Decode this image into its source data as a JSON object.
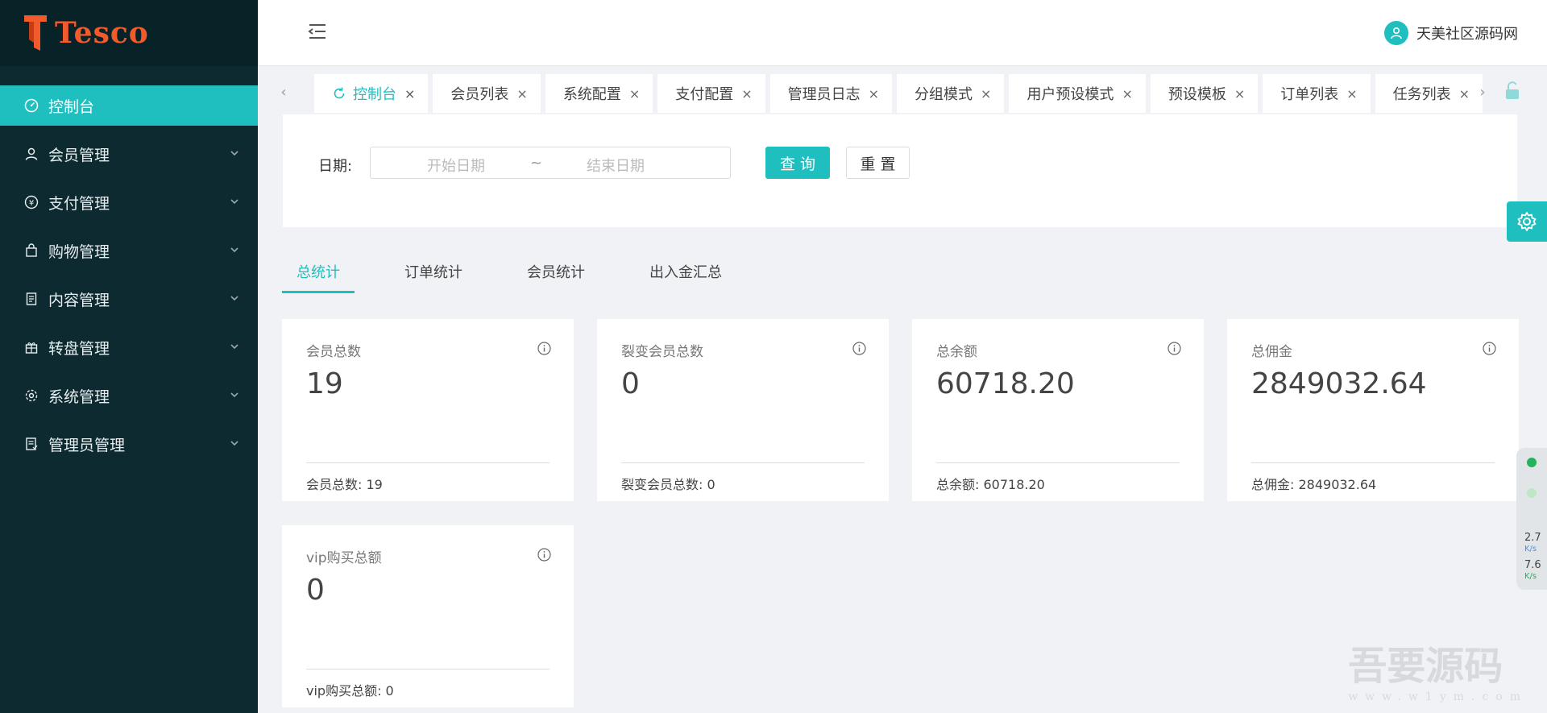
{
  "app": {
    "logo_text": "Tesco",
    "brand_color": "#f25a2b",
    "accent_color": "#1fbfbf"
  },
  "sidebar": {
    "items": [
      {
        "label": "控制台",
        "icon": "dashboard-icon",
        "active": true
      },
      {
        "label": "会员管理",
        "icon": "user-icon"
      },
      {
        "label": "支付管理",
        "icon": "yen-icon"
      },
      {
        "label": "购物管理",
        "icon": "bag-icon"
      },
      {
        "label": "内容管理",
        "icon": "document-icon"
      },
      {
        "label": "转盘管理",
        "icon": "gift-icon"
      },
      {
        "label": "系统管理",
        "icon": "gear-icon"
      },
      {
        "label": "管理员管理",
        "icon": "admin-list-icon"
      }
    ]
  },
  "header": {
    "username": "天美社区源码网"
  },
  "tabs": [
    {
      "label": "控制台",
      "active": true
    },
    {
      "label": "会员列表"
    },
    {
      "label": "系统配置"
    },
    {
      "label": "支付配置"
    },
    {
      "label": "管理员日志"
    },
    {
      "label": "分组模式"
    },
    {
      "label": "用户预设模式"
    },
    {
      "label": "预设模板"
    },
    {
      "label": "订单列表"
    },
    {
      "label": "任务列表"
    }
  ],
  "tab_close_glyph": "×",
  "tab_nav": {
    "prev": "‹",
    "next": "›"
  },
  "filter": {
    "date_label": "日期:",
    "start_placeholder": "开始日期",
    "separator": "~",
    "end_placeholder": "结束日期",
    "query_label": "查 询",
    "reset_label": "重 置"
  },
  "stat_tabs": [
    {
      "label": "总统计",
      "active": true
    },
    {
      "label": "订单统计"
    },
    {
      "label": "会员统计"
    },
    {
      "label": "出入金汇总"
    }
  ],
  "cards": [
    {
      "title": "会员总数",
      "value": "19",
      "footer": "会员总数: 19"
    },
    {
      "title": "裂变会员总数",
      "value": "0",
      "footer": "裂变会员总数: 0"
    },
    {
      "title": "总余额",
      "value": "60718.20",
      "footer": "总余额: 60718.20"
    },
    {
      "title": "总佣金",
      "value": "2849032.64",
      "footer": "总佣金: 2849032.64"
    },
    {
      "title": "vip购买总额",
      "value": "0",
      "footer": "vip购买总额: 0"
    }
  ],
  "side_widget": {
    "up_value": "2.7",
    "up_unit": "K/s",
    "down_value": "7.6",
    "down_unit": "K/s"
  },
  "watermark": {
    "text": "吾要源码",
    "url": "www.w1ym.com"
  }
}
